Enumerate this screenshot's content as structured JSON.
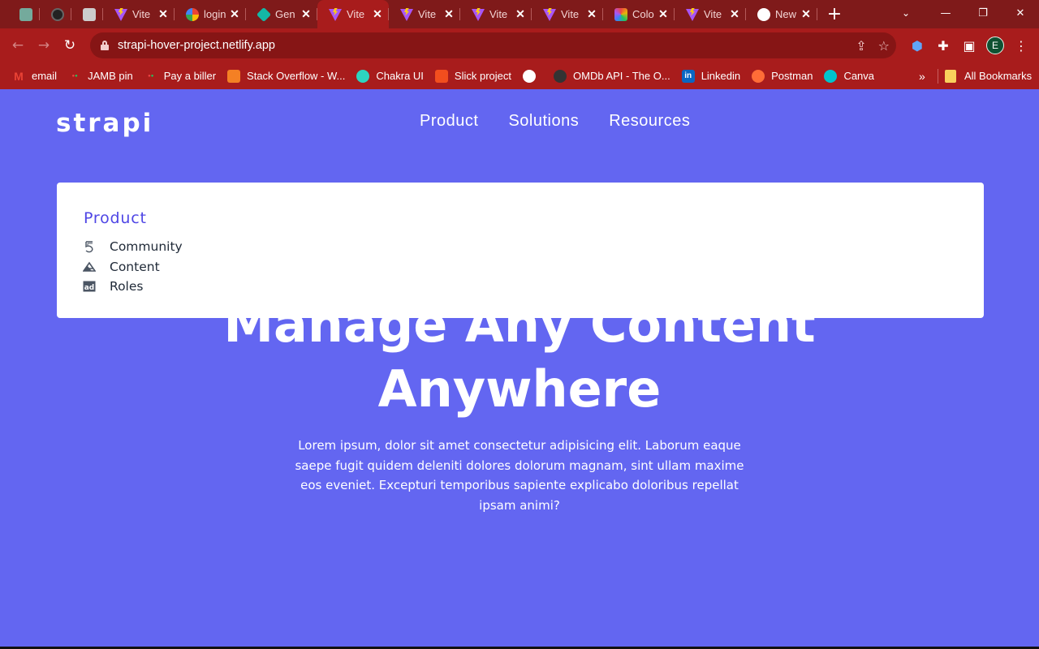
{
  "browser": {
    "tabs": [
      {
        "title": "",
        "icon": "chatgpt-icon",
        "type": "small"
      },
      {
        "title": "",
        "icon": "github-icon",
        "type": "small"
      },
      {
        "title": "",
        "icon": "app-icon",
        "type": "small"
      },
      {
        "title": "Vite",
        "icon": "vite-icon",
        "type": "normal"
      },
      {
        "title": "login",
        "icon": "google-icon",
        "type": "normal"
      },
      {
        "title": "Gen",
        "icon": "diamond-icon",
        "type": "normal"
      },
      {
        "title": "Vite",
        "icon": "vite-icon",
        "type": "normal",
        "active": true
      },
      {
        "title": "Vite",
        "icon": "vite-icon",
        "type": "normal"
      },
      {
        "title": "Vite",
        "icon": "vite-icon",
        "type": "normal"
      },
      {
        "title": "Vite",
        "icon": "vite-icon",
        "type": "normal"
      },
      {
        "title": "Colo",
        "icon": "color-icon",
        "type": "normal"
      },
      {
        "title": "Vite",
        "icon": "vite-icon",
        "type": "normal"
      },
      {
        "title": "New",
        "icon": "chrome-icon",
        "type": "normal"
      }
    ],
    "url": "strapi-hover-project.netlify.app",
    "profile_initial": "E",
    "bookmarks": [
      {
        "label": "email",
        "icon": "gmail-icon",
        "color": "#ea4335"
      },
      {
        "label": "JAMB pin",
        "icon": "dots-icon",
        "color": "#22c55e"
      },
      {
        "label": "Pay a biller",
        "icon": "dots-icon",
        "color": "#22c55e"
      },
      {
        "label": "Stack Overflow - W...",
        "icon": "stackoverflow-icon",
        "color": "#f48024"
      },
      {
        "label": "Chakra UI",
        "icon": "chakra-icon",
        "color": "#2dd4bf"
      },
      {
        "label": "Slick project",
        "icon": "figma-icon",
        "color": "#f24e1e"
      },
      {
        "label": "",
        "icon": "globe-icon",
        "color": "#ffffff"
      },
      {
        "label": "OMDb API - The O...",
        "icon": "film-icon",
        "color": "#333333"
      },
      {
        "label": "Linkedin",
        "icon": "linkedin-icon",
        "color": "#0a66c2"
      },
      {
        "label": "Postman",
        "icon": "postman-icon",
        "color": "#ff6c37"
      },
      {
        "label": "Canva",
        "icon": "canva-icon",
        "color": "#00c4cc"
      }
    ],
    "bookmarks_overflow": "»",
    "all_bookmarks": "All Bookmarks"
  },
  "site": {
    "logo": "strapi",
    "nav": [
      "Product",
      "Solutions",
      "Resources"
    ],
    "dropdown": {
      "heading": "Product",
      "items": [
        {
          "label": "Community",
          "icon": "community-icon"
        },
        {
          "label": "Content",
          "icon": "content-icon"
        },
        {
          "label": "Roles",
          "icon": "roles-icon"
        }
      ]
    },
    "hero": {
      "title_line1": "Manage Any Content",
      "title_line2": "Anywhere",
      "text": "Lorem ipsum, dolor sit amet consectetur adipisicing elit. Laborum eaque saepe fugit quidem deleniti dolores dolorum magnam, sint ullam maxime eos eveniet. Excepturi temporibus sapiente explicabo doloribus repellat ipsam animi?"
    }
  },
  "colors": {
    "page_background": "#6366f1",
    "chrome_dark": "#7f1a1a",
    "chrome": "#a81c1c",
    "dropdown_heading": "#4f46e5"
  }
}
